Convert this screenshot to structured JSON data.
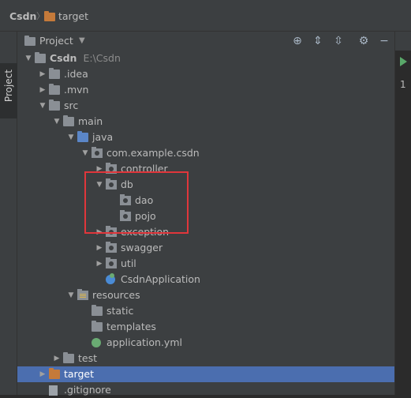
{
  "breadcrumb": {
    "project": "Csdn",
    "folder": "target"
  },
  "tool_window_tab": "Project",
  "panel": {
    "title": "Project",
    "icons": [
      "locate-icon",
      "expand-all-icon",
      "collapse-all-icon",
      "gear-icon",
      "minimize-icon"
    ]
  },
  "tree": [
    {
      "name": "Csdn",
      "path": "E:\\Csdn",
      "level": 0,
      "arrow": "down",
      "icon": "folder",
      "bold": true
    },
    {
      "name": ".idea",
      "level": 1,
      "arrow": "right",
      "icon": "folder"
    },
    {
      "name": ".mvn",
      "level": 1,
      "arrow": "right",
      "icon": "folder"
    },
    {
      "name": "src",
      "level": 1,
      "arrow": "down",
      "icon": "folder"
    },
    {
      "name": "main",
      "level": 2,
      "arrow": "down",
      "icon": "folder"
    },
    {
      "name": "java",
      "level": 3,
      "arrow": "down",
      "icon": "folder-blue"
    },
    {
      "name": "com.example.csdn",
      "level": 4,
      "arrow": "down",
      "icon": "package"
    },
    {
      "name": "controller",
      "level": 5,
      "arrow": "right",
      "icon": "package"
    },
    {
      "name": "db",
      "level": 5,
      "arrow": "down",
      "icon": "package"
    },
    {
      "name": "dao",
      "level": 6,
      "arrow": "none",
      "icon": "package"
    },
    {
      "name": "pojo",
      "level": 6,
      "arrow": "none",
      "icon": "package"
    },
    {
      "name": "exception",
      "level": 5,
      "arrow": "right",
      "icon": "package"
    },
    {
      "name": "swagger",
      "level": 5,
      "arrow": "right",
      "icon": "package"
    },
    {
      "name": "util",
      "level": 5,
      "arrow": "right",
      "icon": "package"
    },
    {
      "name": "CsdnApplication",
      "level": 5,
      "arrow": "none",
      "icon": "spring-class"
    },
    {
      "name": "resources",
      "level": 3,
      "arrow": "down",
      "icon": "resources"
    },
    {
      "name": "static",
      "level": 4,
      "arrow": "none",
      "icon": "folder"
    },
    {
      "name": "templates",
      "level": 4,
      "arrow": "none",
      "icon": "folder"
    },
    {
      "name": "application.yml",
      "level": 4,
      "arrow": "none",
      "icon": "yml"
    },
    {
      "name": "test",
      "level": 2,
      "arrow": "right",
      "icon": "folder"
    },
    {
      "name": "target",
      "level": 1,
      "arrow": "right",
      "icon": "folder-orange",
      "selected": true
    },
    {
      "name": ".gitignore",
      "level": 1,
      "arrow": "none",
      "icon": "file"
    }
  ],
  "editor": {
    "line_number": "1"
  },
  "colors": {
    "selection": "#4b6eaf",
    "highlight_box": "#e0363b",
    "background": "#3c3f41"
  }
}
